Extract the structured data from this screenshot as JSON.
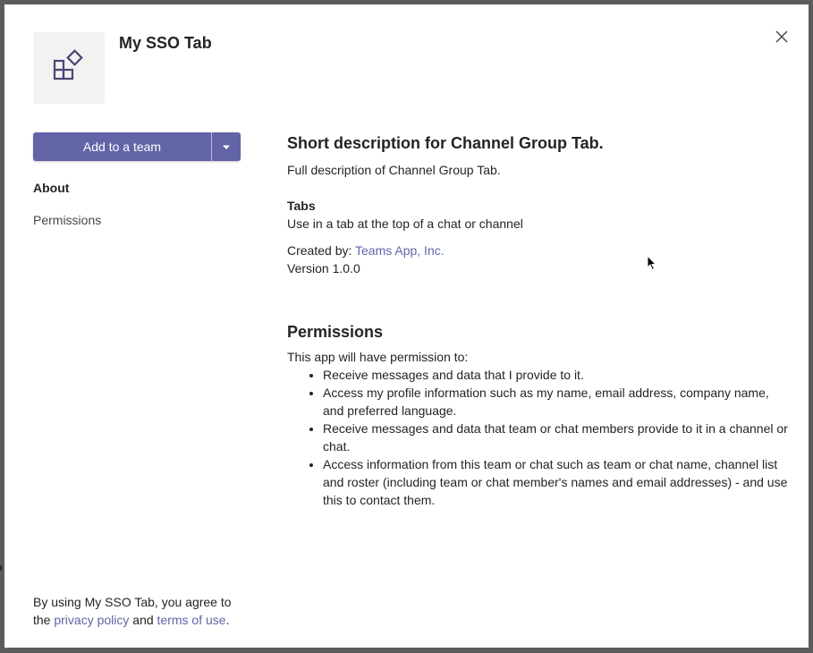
{
  "app": {
    "title": "My SSO Tab",
    "icon": "app-puzzle-icon"
  },
  "actions": {
    "add_label": "Add to a team",
    "dropdown_icon": "caret-down-icon"
  },
  "nav": {
    "about": "About",
    "permissions": "Permissions"
  },
  "about": {
    "short_description": "Short description for Channel Group Tab.",
    "full_description": "Full description of Channel Group Tab.",
    "tabs_label": "Tabs",
    "tabs_description": "Use in a tab at the top of a chat or channel",
    "created_by_label": "Created by: ",
    "created_by_value": "Teams App, Inc.",
    "version": "Version 1.0.0"
  },
  "permissions": {
    "heading": "Permissions",
    "intro": "This app will have permission to:",
    "items": [
      "Receive messages and data that I provide to it.",
      "Access my profile information such as my name, email address, company name, and preferred language.",
      "Receive messages and data that team or chat members provide to it in a channel or chat.",
      "Access information from this team or chat such as team or chat name, channel list and roster (including team or chat member's names and email addresses) - and use this to contact them."
    ]
  },
  "footer": {
    "text_1": "By using My SSO Tab, you agree to the ",
    "privacy": "privacy policy",
    "and": " and ",
    "terms": "terms of use",
    "end": "."
  },
  "colors": {
    "brand": "#6264a7",
    "icon_bg": "#f3f2f1"
  }
}
